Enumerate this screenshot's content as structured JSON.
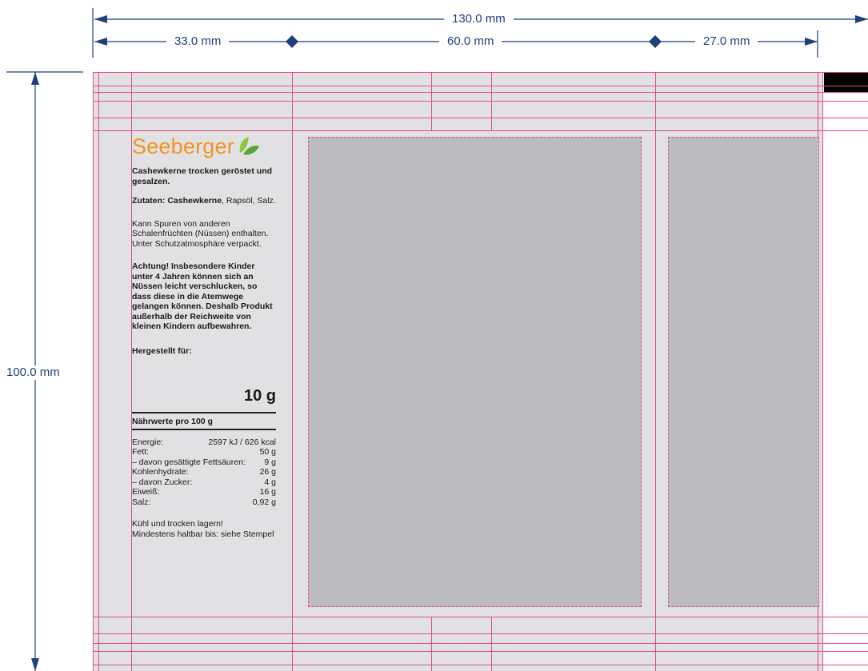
{
  "dimensions": {
    "total_width": "130.0 mm",
    "left_width": "33.0 mm",
    "center_width": "60.0 mm",
    "right_width": "27.0 mm",
    "height": "100.0 mm"
  },
  "colors": {
    "dimension_line": "#1d3f7a",
    "guide": "#e0498f",
    "artboard": "#e1e1e3",
    "placeholder": "#bcbcc0",
    "brand_orange": "#f39422",
    "brand_green": "#7db83a"
  },
  "label": {
    "brand": "Seeberger",
    "product_name": "Cashewkerne trocken geröstet und gesalzen.",
    "ingredients_label": "Zutaten: Cashewkerne",
    "ingredients_rest": ", Rapsöl, Salz.",
    "traces": "Kann Spuren von anderen Schalenfrüchten (Nüssen) enthalten. Unter Schutzatmosphäre verpackt.",
    "warning": "Achtung! Insbesondere Kinder unter 4 Jahren können sich an Nüssen leicht verschlucken, so dass diese in die Atemwege gelangen können. Deshalb Produkt außerhalb der Reichweite von kleinen Kindern aufbewahren.",
    "manufactured_for": "Hergestellt für:",
    "net_weight": "10 g",
    "nutrition_title": "Nährwerte pro 100 g",
    "nutrition": [
      {
        "name": "Energie:",
        "value": "2597 kJ / 626 kcal"
      },
      {
        "name": "Fett:",
        "value": "50 g"
      },
      {
        "name": " – davon gesättigte Fettsäuren:",
        "value": "9 g"
      },
      {
        "name": "Kohlenhydrate:",
        "value": "26 g"
      },
      {
        "name": " – davon Zucker:",
        "value": "4 g"
      },
      {
        "name": "Eiweiß:",
        "value": "16 g"
      },
      {
        "name": "Salz:",
        "value": "0,92 g"
      }
    ],
    "storage": "Kühl und trocken lagern!",
    "best_before": "Mindestens haltbar bis: siehe Stempel"
  }
}
